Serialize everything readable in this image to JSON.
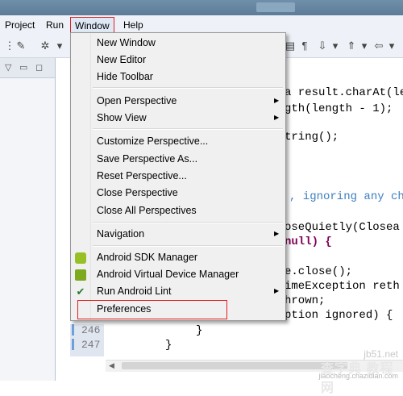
{
  "menubar": {
    "items": [
      "Project",
      "Run",
      "Window",
      "Help"
    ]
  },
  "window_menu": {
    "groups": [
      [
        "New Window",
        "New Editor",
        "Hide Toolbar"
      ],
      [
        "Open Perspective",
        "Show View"
      ],
      [
        "Customize Perspective...",
        "Save Perspective As...",
        "Reset Perspective...",
        "Close Perspective",
        "Close All Perspectives"
      ],
      [
        "Navigation"
      ],
      [
        "Android SDK Manager",
        "Android Virtual Device Manager",
        "Run Android Lint"
      ],
      [
        "Preferences"
      ]
    ],
    "submenu_items": [
      "Open Perspective",
      "Show View",
      "Navigation",
      "Run Android Lint"
    ]
  },
  "editor": {
    "lines": [
      "a result.charAt(le",
      "gth(length - 1);",
      "tring();",
      ", ignoring any ch",
      "oseQuietly(Closea",
      "null) {",
      "e.close();",
      "imeException reth",
      "hrown;",
      "ption ignored) {",
      "}",
      "}"
    ],
    "line_numbers": [
      "246",
      "247"
    ]
  },
  "watermark": {
    "top": "jb51.net",
    "middle": "查字典 教程网",
    "bottom": "jiaocheng.chazidian.com"
  },
  "colors": {
    "highlight_border": "#e02020",
    "keyword": "#7f0055",
    "comment": "#3f7fbf"
  }
}
